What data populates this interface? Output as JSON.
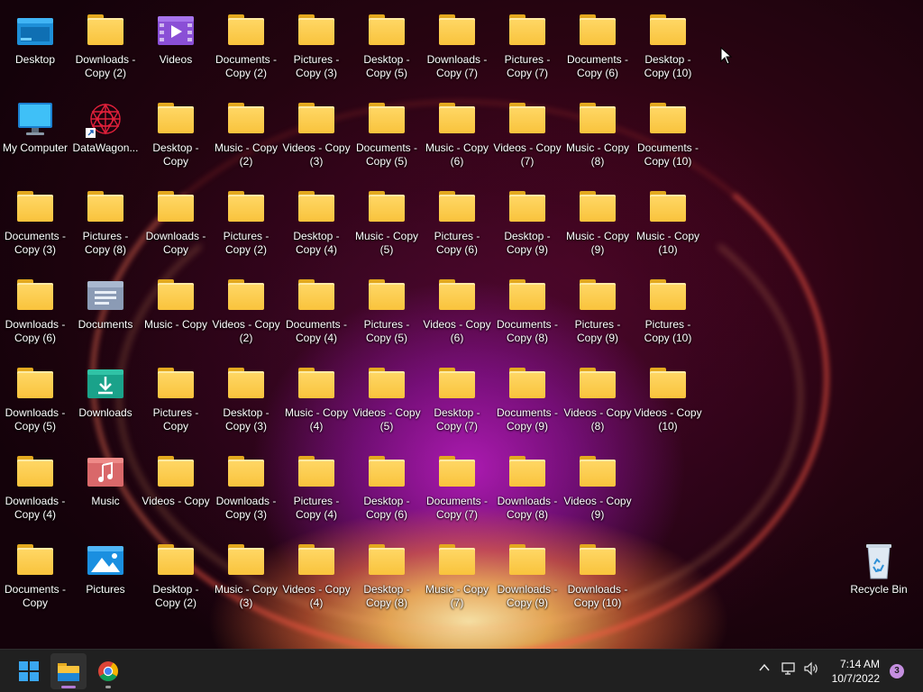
{
  "desktop": {
    "column_a": [
      "Desktop",
      "My Computer",
      "Documents - Copy (3)",
      "Downloads - Copy (6)",
      "Downloads - Copy (5)",
      "Downloads - Copy (4)",
      "Documents - Copy"
    ],
    "column_b": [
      "Downloads - Copy (2)",
      "DataWagon...",
      "Pictures - Copy (8)",
      "Documents",
      "Downloads",
      "Music",
      "Pictures"
    ],
    "column_c": [
      "Videos",
      "Desktop - Copy",
      "Downloads - Copy",
      "Music - Copy",
      "Pictures - Copy",
      "Videos - Copy",
      "Desktop - Copy (2)"
    ],
    "column_d": [
      "Documents - Copy (2)",
      "Music - Copy (2)",
      "Pictures - Copy (2)",
      "Videos - Copy (2)",
      "Desktop - Copy (3)",
      "Downloads - Copy (3)",
      "Music - Copy (3)"
    ],
    "column_e": [
      "Pictures - Copy (3)",
      "Videos - Copy (3)",
      "Desktop - Copy (4)",
      "Documents - Copy (4)",
      "Music - Copy (4)",
      "Pictures - Copy (4)",
      "Videos - Copy (4)"
    ],
    "column_f": [
      "Desktop - Copy (5)",
      "Documents - Copy (5)",
      "Music - Copy (5)",
      "Pictures - Copy (5)",
      "Videos - Copy (5)",
      "Desktop - Copy (6)",
      "Desktop - Copy (8)"
    ],
    "column_g": [
      "Downloads - Copy (7)",
      "Music - Copy (6)",
      "Pictures - Copy (6)",
      "Videos - Copy (6)",
      "Desktop - Copy (7)",
      "Documents - Copy (7)",
      "Music - Copy (7)"
    ],
    "column_h": [
      "Pictures - Copy (7)",
      "Videos - Copy (7)",
      "Desktop - Copy (9)",
      "Documents - Copy (8)",
      "Documents - Copy (9)",
      "Downloads - Copy (8)",
      "Downloads - Copy (9)"
    ],
    "column_i": [
      "Documents - Copy (6)",
      "Music - Copy (8)",
      "Music - Copy (9)",
      "Pictures - Copy (9)",
      "Videos - Copy (8)",
      "Videos - Copy (9)",
      "Downloads - Copy (10)"
    ],
    "column_j": [
      "Desktop - Copy (10)",
      "Documents - Copy (10)",
      "Music - Copy (10)",
      "Pictures - Copy (10)",
      "Videos - Copy (10)"
    ],
    "recycle_bin": "Recycle Bin"
  },
  "taskbar": {
    "time": "7:14 AM",
    "date": "10/7/2022",
    "notification_count": "3",
    "tray_chevron_icon": "chevron-up-icon",
    "network_icon": "network-icon",
    "volume_icon": "volume-icon"
  },
  "colors": {
    "folder": "#f9c33c",
    "taskbar": "#202020",
    "accent": "#b37ad6"
  }
}
